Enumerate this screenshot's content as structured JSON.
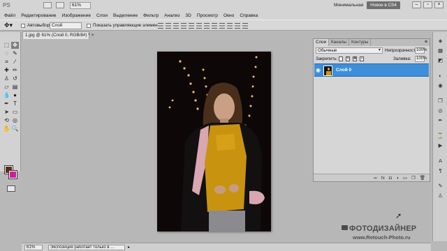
{
  "app": {
    "logo": "PS",
    "zoom": "61%",
    "workspace_label": "Минимальная",
    "workspace_button": "Новое в CS4"
  },
  "menu": [
    "Файл",
    "Редактирование",
    "Изображение",
    "Слои",
    "Выделение",
    "Фильтр",
    "Анализ",
    "3D",
    "Просмотр",
    "Окно",
    "Справка"
  ],
  "options": {
    "autoselect_label": "Автовыбор:",
    "autoselect_value": "Слой",
    "show_controls_label": "Показать управляющие элементы"
  },
  "document": {
    "tab_title": "1.jpg @ 61% (Слой 0, RGB/8#) *"
  },
  "status": {
    "zoom": "61%",
    "message": "Экспозиция работает только в ..."
  },
  "layers_panel": {
    "tabs": [
      "Слои",
      "Каналы",
      "Контуры"
    ],
    "blend_mode": "Обычные",
    "opacity_label": "Непрозрачность:",
    "opacity_value": "100%",
    "lock_label": "Закрепить:",
    "fill_label": "Заливка:",
    "fill_value": "100%",
    "layers": [
      {
        "name": "Слой 0",
        "visible": true,
        "selected": true
      }
    ]
  },
  "colors": {
    "foreground": "#5a2e1c",
    "background": "#cc1e9a",
    "layer_selected": "#3c8fd8"
  },
  "watermark": {
    "title": "ФОТОДИЗАЙНЕР",
    "url": "www.Retouch-Photo.ru"
  }
}
